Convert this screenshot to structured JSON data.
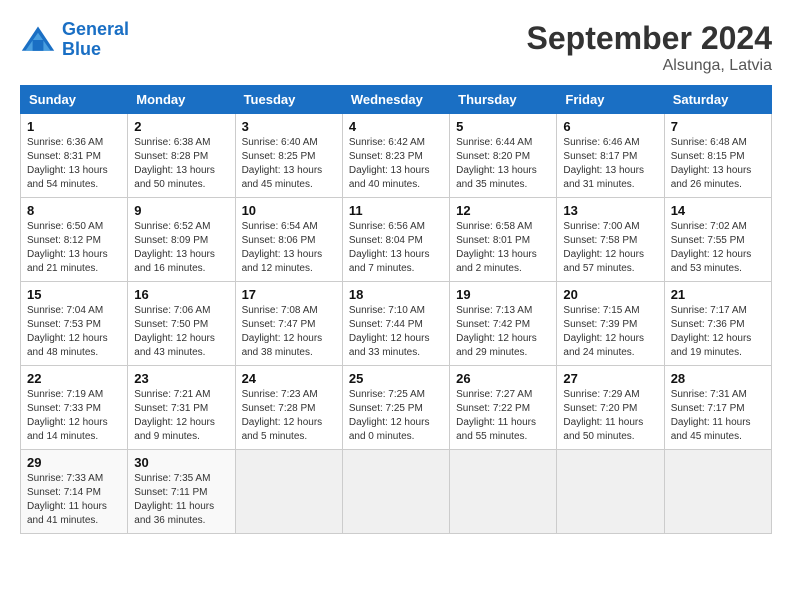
{
  "logo": {
    "text_general": "General",
    "text_blue": "Blue"
  },
  "title": "September 2024",
  "location": "Alsunga, Latvia",
  "weekdays": [
    "Sunday",
    "Monday",
    "Tuesday",
    "Wednesday",
    "Thursday",
    "Friday",
    "Saturday"
  ],
  "weeks": [
    [
      {
        "day": "1",
        "info": "Sunrise: 6:36 AM\nSunset: 8:31 PM\nDaylight: 13 hours\nand 54 minutes."
      },
      {
        "day": "2",
        "info": "Sunrise: 6:38 AM\nSunset: 8:28 PM\nDaylight: 13 hours\nand 50 minutes."
      },
      {
        "day": "3",
        "info": "Sunrise: 6:40 AM\nSunset: 8:25 PM\nDaylight: 13 hours\nand 45 minutes."
      },
      {
        "day": "4",
        "info": "Sunrise: 6:42 AM\nSunset: 8:23 PM\nDaylight: 13 hours\nand 40 minutes."
      },
      {
        "day": "5",
        "info": "Sunrise: 6:44 AM\nSunset: 8:20 PM\nDaylight: 13 hours\nand 35 minutes."
      },
      {
        "day": "6",
        "info": "Sunrise: 6:46 AM\nSunset: 8:17 PM\nDaylight: 13 hours\nand 31 minutes."
      },
      {
        "day": "7",
        "info": "Sunrise: 6:48 AM\nSunset: 8:15 PM\nDaylight: 13 hours\nand 26 minutes."
      }
    ],
    [
      {
        "day": "8",
        "info": "Sunrise: 6:50 AM\nSunset: 8:12 PM\nDaylight: 13 hours\nand 21 minutes."
      },
      {
        "day": "9",
        "info": "Sunrise: 6:52 AM\nSunset: 8:09 PM\nDaylight: 13 hours\nand 16 minutes."
      },
      {
        "day": "10",
        "info": "Sunrise: 6:54 AM\nSunset: 8:06 PM\nDaylight: 13 hours\nand 12 minutes."
      },
      {
        "day": "11",
        "info": "Sunrise: 6:56 AM\nSunset: 8:04 PM\nDaylight: 13 hours\nand 7 minutes."
      },
      {
        "day": "12",
        "info": "Sunrise: 6:58 AM\nSunset: 8:01 PM\nDaylight: 13 hours\nand 2 minutes."
      },
      {
        "day": "13",
        "info": "Sunrise: 7:00 AM\nSunset: 7:58 PM\nDaylight: 12 hours\nand 57 minutes."
      },
      {
        "day": "14",
        "info": "Sunrise: 7:02 AM\nSunset: 7:55 PM\nDaylight: 12 hours\nand 53 minutes."
      }
    ],
    [
      {
        "day": "15",
        "info": "Sunrise: 7:04 AM\nSunset: 7:53 PM\nDaylight: 12 hours\nand 48 minutes."
      },
      {
        "day": "16",
        "info": "Sunrise: 7:06 AM\nSunset: 7:50 PM\nDaylight: 12 hours\nand 43 minutes."
      },
      {
        "day": "17",
        "info": "Sunrise: 7:08 AM\nSunset: 7:47 PM\nDaylight: 12 hours\nand 38 minutes."
      },
      {
        "day": "18",
        "info": "Sunrise: 7:10 AM\nSunset: 7:44 PM\nDaylight: 12 hours\nand 33 minutes."
      },
      {
        "day": "19",
        "info": "Sunrise: 7:13 AM\nSunset: 7:42 PM\nDaylight: 12 hours\nand 29 minutes."
      },
      {
        "day": "20",
        "info": "Sunrise: 7:15 AM\nSunset: 7:39 PM\nDaylight: 12 hours\nand 24 minutes."
      },
      {
        "day": "21",
        "info": "Sunrise: 7:17 AM\nSunset: 7:36 PM\nDaylight: 12 hours\nand 19 minutes."
      }
    ],
    [
      {
        "day": "22",
        "info": "Sunrise: 7:19 AM\nSunset: 7:33 PM\nDaylight: 12 hours\nand 14 minutes."
      },
      {
        "day": "23",
        "info": "Sunrise: 7:21 AM\nSunset: 7:31 PM\nDaylight: 12 hours\nand 9 minutes."
      },
      {
        "day": "24",
        "info": "Sunrise: 7:23 AM\nSunset: 7:28 PM\nDaylight: 12 hours\nand 5 minutes."
      },
      {
        "day": "25",
        "info": "Sunrise: 7:25 AM\nSunset: 7:25 PM\nDaylight: 12 hours\nand 0 minutes."
      },
      {
        "day": "26",
        "info": "Sunrise: 7:27 AM\nSunset: 7:22 PM\nDaylight: 11 hours\nand 55 minutes."
      },
      {
        "day": "27",
        "info": "Sunrise: 7:29 AM\nSunset: 7:20 PM\nDaylight: 11 hours\nand 50 minutes."
      },
      {
        "day": "28",
        "info": "Sunrise: 7:31 AM\nSunset: 7:17 PM\nDaylight: 11 hours\nand 45 minutes."
      }
    ],
    [
      {
        "day": "29",
        "info": "Sunrise: 7:33 AM\nSunset: 7:14 PM\nDaylight: 11 hours\nand 41 minutes."
      },
      {
        "day": "30",
        "info": "Sunrise: 7:35 AM\nSunset: 7:11 PM\nDaylight: 11 hours\nand 36 minutes."
      },
      {
        "day": "",
        "info": ""
      },
      {
        "day": "",
        "info": ""
      },
      {
        "day": "",
        "info": ""
      },
      {
        "day": "",
        "info": ""
      },
      {
        "day": "",
        "info": ""
      }
    ]
  ]
}
